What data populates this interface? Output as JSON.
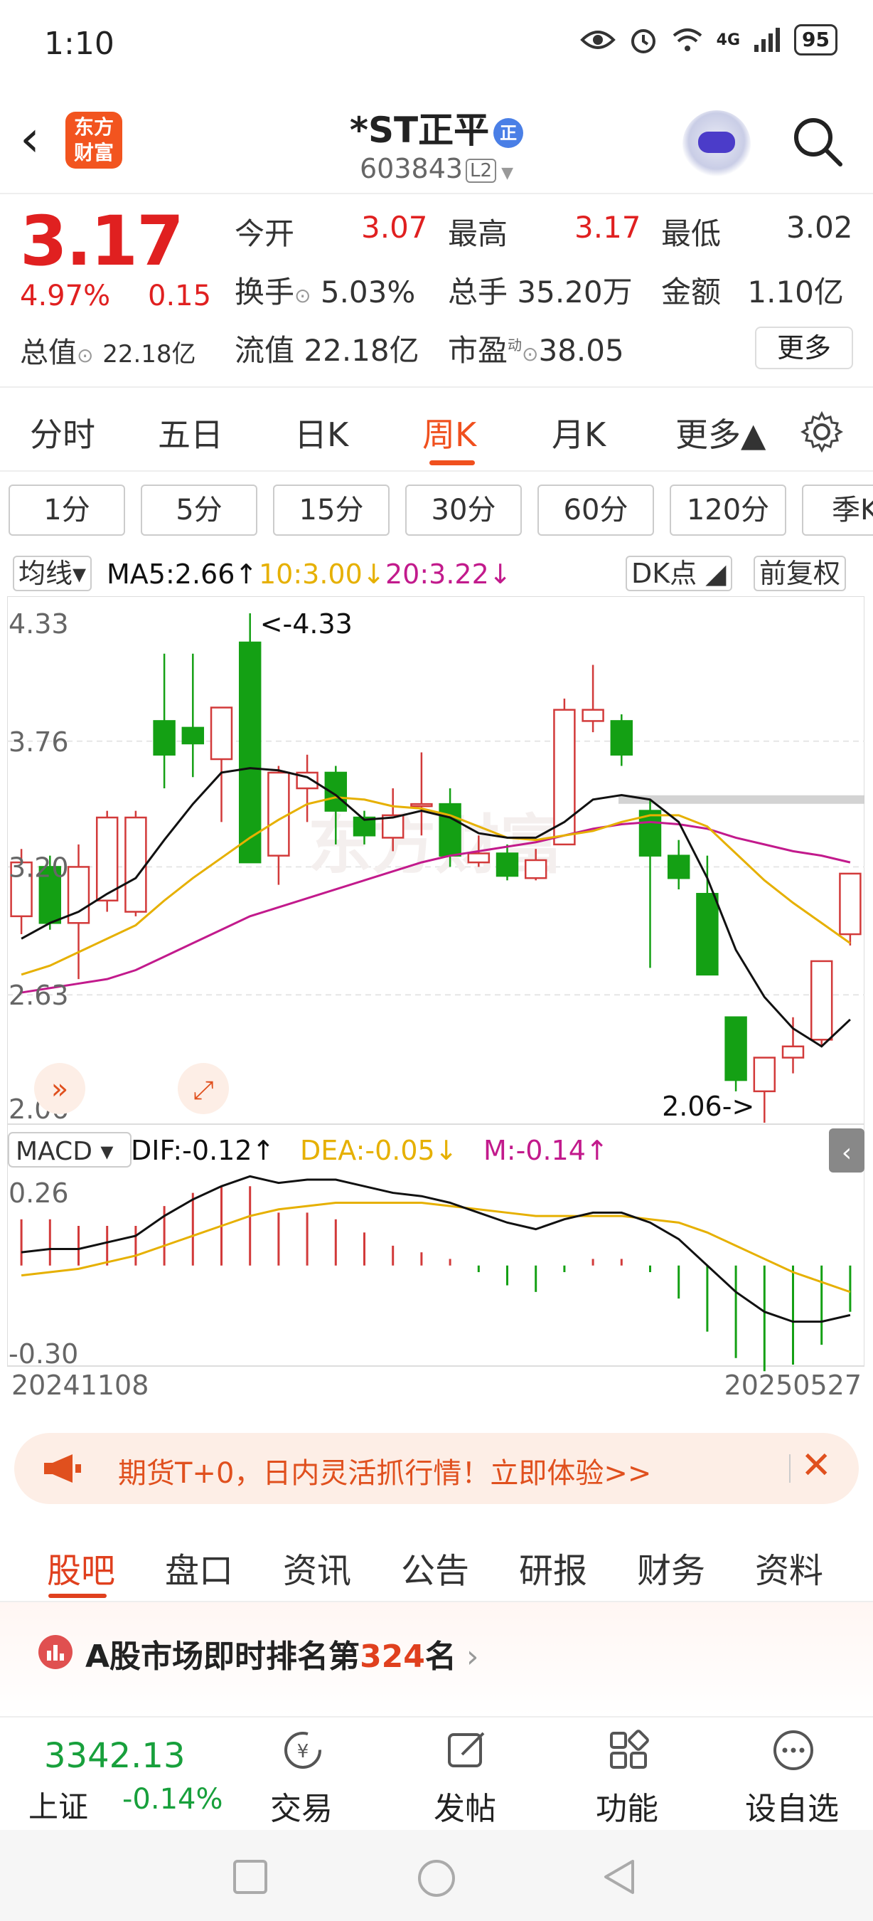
{
  "status": {
    "time": "1:10",
    "battery": "95",
    "network": "4G"
  },
  "header": {
    "logo_line1": "东方",
    "logo_line2": "财富",
    "title": "*ST正平",
    "badge": "正",
    "code": "603843",
    "level": "L2"
  },
  "quote": {
    "price": "3.17",
    "change_pct": "4.97%",
    "change": "0.15",
    "open_label": "今开",
    "open": "3.07",
    "high_label": "最高",
    "high": "3.17",
    "low_label": "最低",
    "low": "3.02",
    "turnover_label": "换手",
    "turnover": "5.03%",
    "volume_label": "总手",
    "volume": "35.20万",
    "amount_label": "金额",
    "amount": "1.10亿",
    "mcap_label": "总值",
    "mcap": "22.18亿",
    "float_label": "流值",
    "float": "22.18亿",
    "pe_label": "市盈",
    "pe_sup": "动",
    "pe": "38.05",
    "more": "更多"
  },
  "tabs": [
    "分时",
    "五日",
    "日K",
    "周K",
    "月K",
    "更多▲"
  ],
  "active_tab": "周K",
  "periods": [
    "1分",
    "5分",
    "15分",
    "30分",
    "60分",
    "120分",
    "季K"
  ],
  "indicators": {
    "ma_select": "均线▾",
    "ma5": "MA5:2.66↑",
    "ma10": "10:3.00↓",
    "ma20": "20:3.22↓",
    "dk": "DK点",
    "adjust": "前复权",
    "ma5_color": "#111111",
    "ma10_color": "#e6b000",
    "ma20_color": "#c21a8c"
  },
  "chart_data": {
    "type": "candlestick",
    "period": "weekly",
    "x_start": "20241108",
    "x_end": "20250527",
    "ylim": [
      2.06,
      4.33
    ],
    "y_ticks": [
      "4.33",
      "3.76",
      "3.20",
      "2.63",
      "2.06"
    ],
    "max_label": "<-4.33",
    "min_label": "2.06->",
    "watermark": "东方财富",
    "candles": [
      {
        "o": 2.98,
        "h": 3.28,
        "l": 2.9,
        "c": 3.22
      },
      {
        "o": 3.2,
        "h": 3.25,
        "l": 2.92,
        "c": 2.95
      },
      {
        "o": 2.95,
        "h": 3.3,
        "l": 2.7,
        "c": 3.2
      },
      {
        "o": 3.05,
        "h": 3.45,
        "l": 3.0,
        "c": 3.42
      },
      {
        "o": 3.0,
        "h": 3.45,
        "l": 2.98,
        "c": 3.42
      },
      {
        "o": 3.85,
        "h": 4.15,
        "l": 3.55,
        "c": 3.7
      },
      {
        "o": 3.82,
        "h": 4.15,
        "l": 3.6,
        "c": 3.75
      },
      {
        "o": 3.68,
        "h": 3.91,
        "l": 3.4,
        "c": 3.91
      },
      {
        "o": 4.2,
        "h": 4.33,
        "l": 3.22,
        "c": 3.22
      },
      {
        "o": 3.25,
        "h": 3.65,
        "l": 3.12,
        "c": 3.62
      },
      {
        "o": 3.55,
        "h": 3.7,
        "l": 3.4,
        "c": 3.62
      },
      {
        "o": 3.62,
        "h": 3.65,
        "l": 3.3,
        "c": 3.45
      },
      {
        "o": 3.42,
        "h": 3.45,
        "l": 3.3,
        "c": 3.34
      },
      {
        "o": 3.33,
        "h": 3.55,
        "l": 3.27,
        "c": 3.43
      },
      {
        "o": 3.48,
        "h": 3.71,
        "l": 3.34,
        "c": 3.48
      },
      {
        "o": 3.48,
        "h": 3.55,
        "l": 3.2,
        "c": 3.25
      },
      {
        "o": 3.22,
        "h": 3.34,
        "l": 3.2,
        "c": 3.26
      },
      {
        "o": 3.26,
        "h": 3.3,
        "l": 3.14,
        "c": 3.16
      },
      {
        "o": 3.15,
        "h": 3.28,
        "l": 3.14,
        "c": 3.23
      },
      {
        "o": 3.3,
        "h": 3.95,
        "l": 3.3,
        "c": 3.9
      },
      {
        "o": 3.85,
        "h": 4.1,
        "l": 3.8,
        "c": 3.9
      },
      {
        "o": 3.85,
        "h": 3.88,
        "l": 3.65,
        "c": 3.7
      },
      {
        "o": 3.45,
        "h": 3.5,
        "l": 2.75,
        "c": 3.25
      },
      {
        "o": 3.25,
        "h": 3.32,
        "l": 3.1,
        "c": 3.15
      },
      {
        "o": 3.08,
        "h": 3.25,
        "l": 2.88,
        "c": 2.72
      },
      {
        "o": 2.53,
        "h": 2.53,
        "l": 2.2,
        "c": 2.25
      },
      {
        "o": 2.2,
        "h": 2.35,
        "l": 2.06,
        "c": 2.35
      },
      {
        "o": 2.35,
        "h": 2.53,
        "l": 2.28,
        "c": 2.4
      },
      {
        "o": 2.43,
        "h": 2.78,
        "l": 2.4,
        "c": 2.78
      },
      {
        "o": 2.9,
        "h": 3.17,
        "l": 2.85,
        "c": 3.17
      }
    ],
    "ma5": [
      2.88,
      2.95,
      3.0,
      3.08,
      3.15,
      3.32,
      3.48,
      3.62,
      3.64,
      3.63,
      3.6,
      3.52,
      3.41,
      3.42,
      3.45,
      3.42,
      3.35,
      3.33,
      3.33,
      3.4,
      3.5,
      3.52,
      3.5,
      3.4,
      3.15,
      2.83,
      2.62,
      2.48,
      2.4,
      2.52
    ],
    "ma10": [
      2.72,
      2.76,
      2.82,
      2.88,
      2.94,
      3.05,
      3.15,
      3.24,
      3.33,
      3.41,
      3.48,
      3.51,
      3.5,
      3.47,
      3.46,
      3.43,
      3.38,
      3.33,
      3.32,
      3.34,
      3.36,
      3.4,
      3.43,
      3.43,
      3.38,
      3.26,
      3.14,
      3.04,
      2.95,
      2.86
    ],
    "ma20": [
      2.64,
      2.66,
      2.68,
      2.7,
      2.74,
      2.8,
      2.86,
      2.92,
      2.98,
      3.02,
      3.06,
      3.1,
      3.14,
      3.18,
      3.22,
      3.25,
      3.27,
      3.29,
      3.31,
      3.34,
      3.37,
      3.39,
      3.4,
      3.39,
      3.37,
      3.33,
      3.3,
      3.27,
      3.25,
      3.22
    ],
    "macd": {
      "select": "MACD ▾",
      "dif_label": "DIF:-0.12↑",
      "dea_label": "DEA:-0.05↓",
      "m_label": "M:-0.14↑",
      "y_ticks": [
        "0.26",
        "-0.30"
      ],
      "ylim": [
        -0.3,
        0.26
      ],
      "dif": [
        0.04,
        0.05,
        0.05,
        0.07,
        0.09,
        0.15,
        0.2,
        0.24,
        0.27,
        0.25,
        0.26,
        0.26,
        0.24,
        0.22,
        0.21,
        0.19,
        0.16,
        0.13,
        0.11,
        0.14,
        0.16,
        0.16,
        0.13,
        0.08,
        0.0,
        -0.08,
        -0.14,
        -0.17,
        -0.17,
        -0.15
      ],
      "dea": [
        -0.03,
        -0.02,
        -0.01,
        0.01,
        0.03,
        0.06,
        0.09,
        0.12,
        0.15,
        0.17,
        0.18,
        0.19,
        0.19,
        0.19,
        0.19,
        0.18,
        0.17,
        0.16,
        0.15,
        0.15,
        0.15,
        0.15,
        0.14,
        0.13,
        0.1,
        0.06,
        0.02,
        -0.02,
        -0.05,
        -0.08
      ],
      "m": [
        0.14,
        0.14,
        0.12,
        0.12,
        0.12,
        0.18,
        0.22,
        0.24,
        0.24,
        0.16,
        0.16,
        0.14,
        0.1,
        0.06,
        0.04,
        0.02,
        -0.02,
        -0.06,
        -0.08,
        -0.02,
        0.02,
        0.02,
        -0.02,
        -0.1,
        -0.2,
        -0.28,
        -0.32,
        -0.3,
        -0.24,
        -0.14
      ]
    }
  },
  "banner": {
    "text": "期货T+0，日内灵活抓行情！立即体验>>"
  },
  "bottom_tabs": [
    "股吧",
    "盘口",
    "资讯",
    "公告",
    "研报",
    "财务",
    "资料"
  ],
  "rank": {
    "prefix": "A股市场即时排名第",
    "num": "324",
    "suffix": "名"
  },
  "footer": {
    "index_value": "3342.13",
    "index_name": "上证",
    "index_change": "-0.14%",
    "items": [
      "交易",
      "发帖",
      "功能",
      "设自选"
    ]
  }
}
